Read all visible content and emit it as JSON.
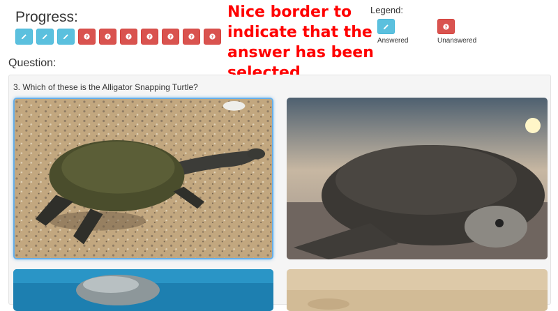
{
  "progress": {
    "title": "Progress:",
    "items": [
      {
        "status": "answered",
        "icon": "pencil-icon"
      },
      {
        "status": "answered",
        "icon": "pencil-icon"
      },
      {
        "status": "answered",
        "icon": "pencil-icon"
      },
      {
        "status": "unanswered",
        "icon": "question-icon"
      },
      {
        "status": "unanswered",
        "icon": "question-icon"
      },
      {
        "status": "unanswered",
        "icon": "question-icon"
      },
      {
        "status": "unanswered",
        "icon": "question-icon"
      },
      {
        "status": "unanswered",
        "icon": "question-icon"
      },
      {
        "status": "unanswered",
        "icon": "question-icon"
      },
      {
        "status": "unanswered",
        "icon": "question-icon"
      }
    ]
  },
  "annotation": {
    "lines": [
      "Nice border to",
      "indicate that the",
      "answer has been",
      "selected"
    ],
    "color": "#ff0000"
  },
  "legend": {
    "title": "Legend:",
    "answered_label": "Answered",
    "unanswered_label": "Unanswered"
  },
  "question": {
    "heading": "Question:",
    "text": "3. Which of these is the Alligator Snapping Turtle?",
    "options": [
      {
        "image": "long-necked-turtle-on-gravel",
        "selected": true
      },
      {
        "image": "sea-turtle-on-beach-at-sunset",
        "selected": false
      },
      {
        "image": "turtle-in-blue-water",
        "selected": false
      },
      {
        "image": "turtle-on-sand",
        "selected": false
      }
    ]
  },
  "colors": {
    "answered": "#5bc0de",
    "unanswered": "#d9534f",
    "selected_border": "#66afe9"
  }
}
